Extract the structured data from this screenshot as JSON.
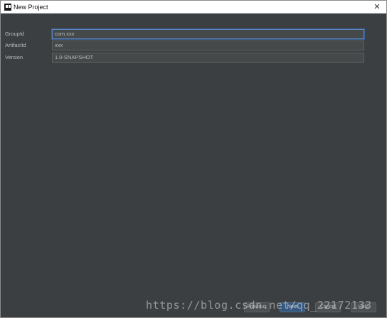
{
  "window": {
    "title": "New Project",
    "close_symbol": "✕"
  },
  "form": {
    "fields": [
      {
        "label": "GroupId",
        "value": "com.xxx"
      },
      {
        "label": "ArtifactId",
        "value": "xxx"
      },
      {
        "label": "Version",
        "value": "1.0-SNAPSHOT"
      }
    ]
  },
  "buttons": {
    "previous": "Previous",
    "next": "Next",
    "cancel": "Cancel",
    "help": "Help"
  },
  "watermark": "https://blog.csdn.net/qq_22172133",
  "colors": {
    "dialog_background": "#3c3f41",
    "focus_border": "#5b86c4",
    "primary_button": "#365880"
  }
}
